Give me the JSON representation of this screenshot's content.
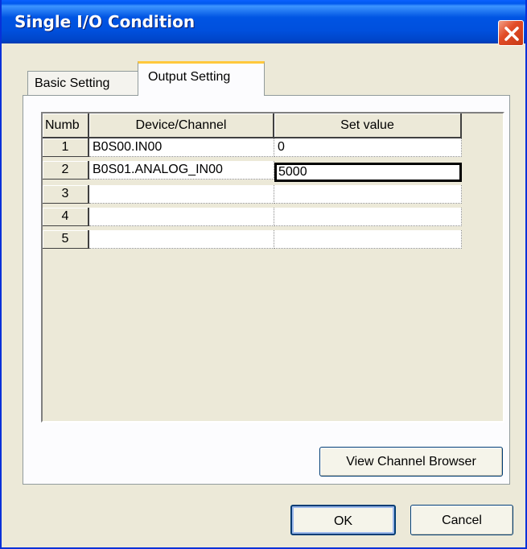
{
  "window": {
    "title": "Single I/O Condition",
    "close_icon": "close-icon"
  },
  "tabs": [
    {
      "label": "Basic Setting",
      "active": false
    },
    {
      "label": "Output Setting",
      "active": true
    }
  ],
  "grid": {
    "columns": [
      "Numb",
      "Device/Channel",
      "Set value"
    ],
    "rows": [
      {
        "num": "1",
        "device": "B0S00.IN00",
        "value": "0"
      },
      {
        "num": "2",
        "device": "B0S01.ANALOG_IN00",
        "value": "5000"
      },
      {
        "num": "3",
        "device": "",
        "value": ""
      },
      {
        "num": "4",
        "device": "",
        "value": ""
      },
      {
        "num": "5",
        "device": "",
        "value": ""
      }
    ],
    "active_cell": "row 2, Set value"
  },
  "buttons": {
    "view_channel_browser": "View Channel Browser",
    "ok": "OK",
    "cancel": "Cancel"
  },
  "colors": {
    "title_bar": "#0054e3",
    "close_button": "#e24c27",
    "active_tab_highlight": "#ffc83c",
    "dialog_face": "#ece9d8"
  }
}
